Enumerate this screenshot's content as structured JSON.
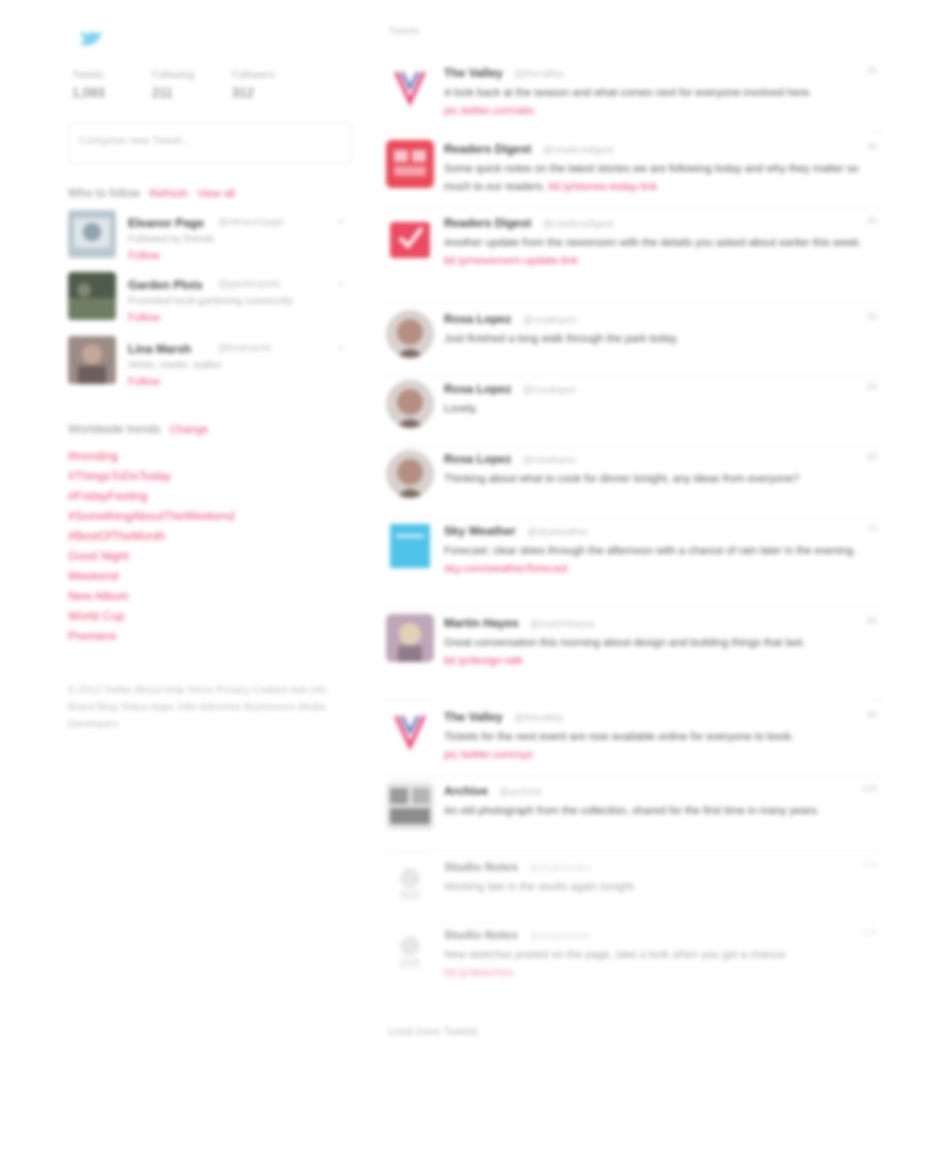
{
  "sidebar": {
    "stats": [
      {
        "label": "Tweets",
        "value": "1,093"
      },
      {
        "label": "Following",
        "value": "211"
      },
      {
        "label": "Followers",
        "value": "312"
      }
    ],
    "compose_placeholder": "Compose new Tweet...",
    "who_to_follow": {
      "title": "Who to follow",
      "refresh": "Refresh",
      "view_all": "View all",
      "users": [
        {
          "name": "Eleanor Page",
          "handle": "@eleanorpage",
          "desc": "Followed by friends",
          "follow": "Follow",
          "dismiss": "×"
        },
        {
          "name": "Garden Plots",
          "handle": "@gardenplots",
          "desc": "Promoted local gardening community",
          "follow": "Follow",
          "dismiss": "×"
        },
        {
          "name": "Lina Marsh",
          "handle": "@linamarsh",
          "desc": "Writer, reader, walker",
          "follow": "Follow",
          "dismiss": "×"
        }
      ]
    },
    "trends": {
      "title": "Worldwide trends",
      "change": "Change",
      "items": [
        "#trending",
        "#ThingsToDoToday",
        "#FridayFeeling",
        "#SomethingAboutTheWeekend",
        "#BestOfTheMonth",
        "Good Night",
        "Weekend",
        "New Album",
        "World Cup",
        "Premiere"
      ]
    },
    "footer": "© 2013 Twitter About Help Terms Privacy Cookies Ads info Brand Blog Status Apps Jobs Advertise Businesses Media Developers"
  },
  "stream": {
    "label": "Tweets",
    "tweets": [
      {
        "name": "The Valley",
        "handle": "@thevalley",
        "time": "2h",
        "text": "A look back at the season and what comes next for everyone involved here.",
        "link": "pic.twitter.com/abc"
      },
      {
        "name": "Readers Digest",
        "handle": "@readersdigest",
        "time": "3h",
        "text": "Some quick notes on the latest stories we are following today and why they matter so much to our readers.",
        "link": "bit.ly/stories-today-link"
      },
      {
        "name": "Readers Digest",
        "handle": "@readersdigest",
        "time": "4h",
        "text": "Another update from the newsroom with the details you asked about earlier this week.",
        "link": "bit.ly/newsroom-update-link"
      },
      {
        "name": "Rosa Lopez",
        "handle": "@rosalopez",
        "time": "5h",
        "text": "Just finished a long walk through the park today.",
        "link": ""
      },
      {
        "name": "Rosa Lopez",
        "handle": "@rosalopez",
        "time": "5h",
        "text": "Lovely.",
        "link": ""
      },
      {
        "name": "Rosa Lopez",
        "handle": "@rosalopez",
        "time": "6h",
        "text": "Thinking about what to cook for dinner tonight, any ideas from everyone?",
        "link": ""
      },
      {
        "name": "Sky Weather",
        "handle": "@skyweather",
        "time": "7h",
        "text": "Forecast: clear skies through the afternoon with a chance of rain later in the evening.",
        "link": "sky.com/weather/forecast"
      },
      {
        "name": "Martin Hayes",
        "handle": "@martinhayes",
        "time": "8h",
        "text": "Great conversation this morning about design and building things that last.",
        "link": "bit.ly/design-talk"
      },
      {
        "name": "The Valley",
        "handle": "@thevalley",
        "time": "9h",
        "text": "Tickets for the next event are now available online for everyone to book.",
        "link": "pic.twitter.com/xyz"
      },
      {
        "name": "Archive",
        "handle": "@archive",
        "time": "10h",
        "text": "An old photograph from the collection, shared for the first time in many years.",
        "link": ""
      },
      {
        "name": "Studio Notes",
        "handle": "@studionotes",
        "time": "11h",
        "text": "Working late in the studio again tonight.",
        "link": ""
      },
      {
        "name": "Studio Notes",
        "handle": "@studionotes",
        "time": "12h",
        "text": "New sketches posted on the page, take a look when you get a chance.",
        "link": "bit.ly/sketches"
      }
    ],
    "load_more": "Load more Tweets"
  }
}
